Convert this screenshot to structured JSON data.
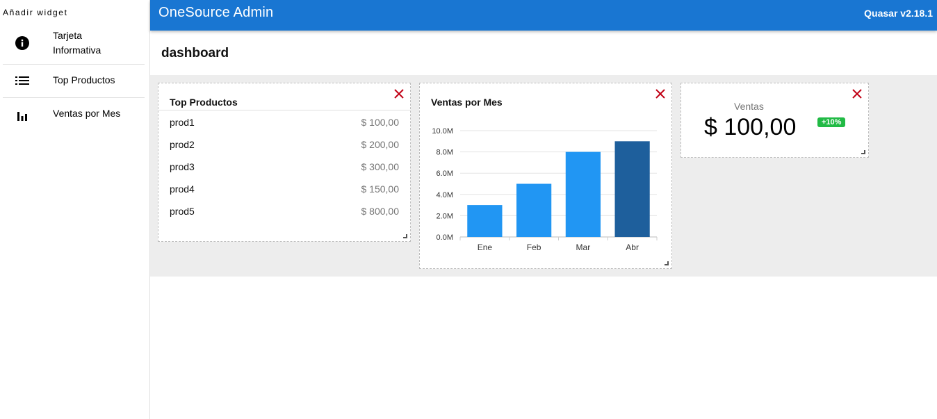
{
  "sidebar": {
    "title": "Añadir widget",
    "items": [
      {
        "label": "Tarjeta Informativa",
        "icon": "info-icon"
      },
      {
        "label": "Top Productos",
        "icon": "list-icon"
      },
      {
        "label": "Ventas por Mes",
        "icon": "bar-chart-icon"
      }
    ]
  },
  "header": {
    "title": "OneSource Admin",
    "version": "Quasar v2.18.1",
    "color": "#1976d2"
  },
  "page": {
    "title": "dashboard"
  },
  "widgets": {
    "top_productos": {
      "title": "Top Productos",
      "rows": [
        {
          "name": "prod1",
          "price": "$ 100,00"
        },
        {
          "name": "prod2",
          "price": "$ 200,00"
        },
        {
          "name": "prod3",
          "price": "$ 300,00"
        },
        {
          "name": "prod4",
          "price": "$ 150,00"
        },
        {
          "name": "prod5",
          "price": "$ 800,00"
        }
      ]
    },
    "ventas_mes": {
      "title": "Ventas por Mes"
    },
    "ventas": {
      "label": "Ventas",
      "value": "$ 100,00",
      "badge": "+10%",
      "badge_color": "#21ba45"
    }
  },
  "chart_data": {
    "type": "bar",
    "categories": [
      "Ene",
      "Feb",
      "Mar",
      "Abr"
    ],
    "values": [
      3000000,
      5000000,
      8000000,
      9000000
    ],
    "yticks": [
      "0.0M",
      "2.0M",
      "4.0M",
      "6.0M",
      "8.0M",
      "10.0M"
    ],
    "ylim": [
      0,
      10000000
    ],
    "bar_colors": [
      "#2196f3",
      "#2196f3",
      "#2196f3",
      "#1e5f9c"
    ],
    "grid": true
  },
  "colors": {
    "close": "#c10015"
  }
}
